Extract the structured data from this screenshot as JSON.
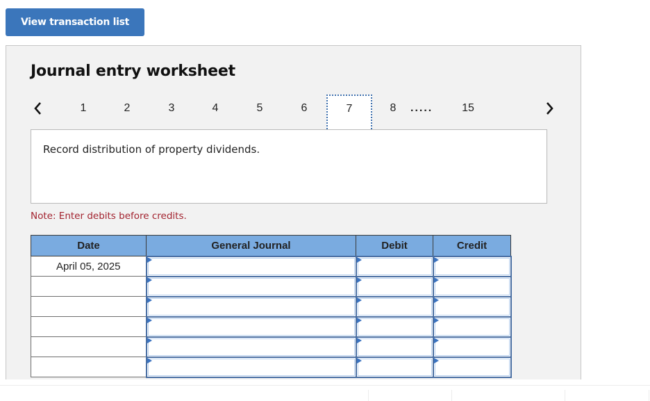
{
  "toolbar": {
    "view_transactions_label": "View transaction list"
  },
  "worksheet": {
    "title": "Journal entry worksheet",
    "pagination": {
      "prev_icon": "chevron-left-icon",
      "next_icon": "chevron-right-icon",
      "pages": [
        "1",
        "2",
        "3",
        "4",
        "5",
        "6"
      ],
      "current": "7",
      "after": [
        "8"
      ],
      "ellipsis": ".....",
      "last": "15"
    },
    "description": "Record distribution of property dividends.",
    "note": "Note: Enter debits before credits.",
    "colors": {
      "accent": "#3b76bb",
      "header": "#7aabe0",
      "note": "#a2222e"
    },
    "table": {
      "headers": {
        "date": "Date",
        "journal": "General Journal",
        "debit": "Debit",
        "credit": "Credit"
      },
      "rows": [
        {
          "date": "April 05, 2025",
          "journal": "",
          "debit": "",
          "credit": ""
        },
        {
          "date": "",
          "journal": "",
          "debit": "",
          "credit": ""
        },
        {
          "date": "",
          "journal": "",
          "debit": "",
          "credit": ""
        },
        {
          "date": "",
          "journal": "",
          "debit": "",
          "credit": ""
        },
        {
          "date": "",
          "journal": "",
          "debit": "",
          "credit": ""
        },
        {
          "date": "",
          "journal": "",
          "debit": "",
          "credit": ""
        }
      ]
    }
  }
}
